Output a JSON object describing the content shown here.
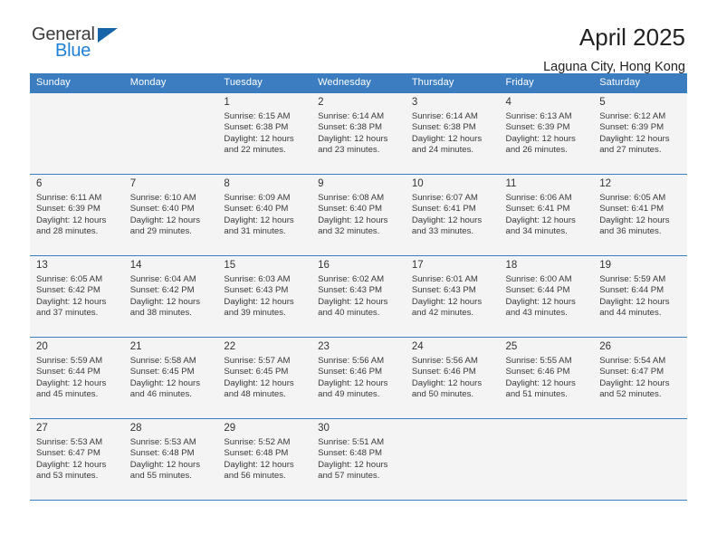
{
  "brand": {
    "name_part1": "General",
    "name_part2": "Blue",
    "accent_color": "#1e7fd4",
    "triangle_color": "#1565a8",
    "triangle_icon": "triangle-icon"
  },
  "header": {
    "title": "April 2025",
    "location": "Laguna City, Hong Kong"
  },
  "calendar": {
    "header_bg": "#3b7dc0",
    "weekday_headers": [
      "Sunday",
      "Monday",
      "Tuesday",
      "Wednesday",
      "Thursday",
      "Friday",
      "Saturday"
    ],
    "labels": {
      "sunrise": "Sunrise:",
      "sunset": "Sunset:",
      "daylight": "Daylight:"
    },
    "weeks": [
      {
        "shaded": true,
        "days": [
          {
            "day": "",
            "sunrise": "",
            "sunset": "",
            "daylight_line1": "",
            "daylight_line2": "",
            "empty": true
          },
          {
            "day": "",
            "sunrise": "",
            "sunset": "",
            "daylight_line1": "",
            "daylight_line2": "",
            "empty": true
          },
          {
            "day": "1",
            "sunrise": "Sunrise: 6:15 AM",
            "sunset": "Sunset: 6:38 PM",
            "daylight_line1": "Daylight: 12 hours",
            "daylight_line2": "and 22 minutes.",
            "empty": false
          },
          {
            "day": "2",
            "sunrise": "Sunrise: 6:14 AM",
            "sunset": "Sunset: 6:38 PM",
            "daylight_line1": "Daylight: 12 hours",
            "daylight_line2": "and 23 minutes.",
            "empty": false
          },
          {
            "day": "3",
            "sunrise": "Sunrise: 6:14 AM",
            "sunset": "Sunset: 6:38 PM",
            "daylight_line1": "Daylight: 12 hours",
            "daylight_line2": "and 24 minutes.",
            "empty": false
          },
          {
            "day": "4",
            "sunrise": "Sunrise: 6:13 AM",
            "sunset": "Sunset: 6:39 PM",
            "daylight_line1": "Daylight: 12 hours",
            "daylight_line2": "and 26 minutes.",
            "empty": false
          },
          {
            "day": "5",
            "sunrise": "Sunrise: 6:12 AM",
            "sunset": "Sunset: 6:39 PM",
            "daylight_line1": "Daylight: 12 hours",
            "daylight_line2": "and 27 minutes.",
            "empty": false
          }
        ]
      },
      {
        "shaded": true,
        "days": [
          {
            "day": "6",
            "sunrise": "Sunrise: 6:11 AM",
            "sunset": "Sunset: 6:39 PM",
            "daylight_line1": "Daylight: 12 hours",
            "daylight_line2": "and 28 minutes.",
            "empty": false
          },
          {
            "day": "7",
            "sunrise": "Sunrise: 6:10 AM",
            "sunset": "Sunset: 6:40 PM",
            "daylight_line1": "Daylight: 12 hours",
            "daylight_line2": "and 29 minutes.",
            "empty": false
          },
          {
            "day": "8",
            "sunrise": "Sunrise: 6:09 AM",
            "sunset": "Sunset: 6:40 PM",
            "daylight_line1": "Daylight: 12 hours",
            "daylight_line2": "and 31 minutes.",
            "empty": false
          },
          {
            "day": "9",
            "sunrise": "Sunrise: 6:08 AM",
            "sunset": "Sunset: 6:40 PM",
            "daylight_line1": "Daylight: 12 hours",
            "daylight_line2": "and 32 minutes.",
            "empty": false
          },
          {
            "day": "10",
            "sunrise": "Sunrise: 6:07 AM",
            "sunset": "Sunset: 6:41 PM",
            "daylight_line1": "Daylight: 12 hours",
            "daylight_line2": "and 33 minutes.",
            "empty": false
          },
          {
            "day": "11",
            "sunrise": "Sunrise: 6:06 AM",
            "sunset": "Sunset: 6:41 PM",
            "daylight_line1": "Daylight: 12 hours",
            "daylight_line2": "and 34 minutes.",
            "empty": false
          },
          {
            "day": "12",
            "sunrise": "Sunrise: 6:05 AM",
            "sunset": "Sunset: 6:41 PM",
            "daylight_line1": "Daylight: 12 hours",
            "daylight_line2": "and 36 minutes.",
            "empty": false
          }
        ]
      },
      {
        "shaded": true,
        "days": [
          {
            "day": "13",
            "sunrise": "Sunrise: 6:05 AM",
            "sunset": "Sunset: 6:42 PM",
            "daylight_line1": "Daylight: 12 hours",
            "daylight_line2": "and 37 minutes.",
            "empty": false
          },
          {
            "day": "14",
            "sunrise": "Sunrise: 6:04 AM",
            "sunset": "Sunset: 6:42 PM",
            "daylight_line1": "Daylight: 12 hours",
            "daylight_line2": "and 38 minutes.",
            "empty": false
          },
          {
            "day": "15",
            "sunrise": "Sunrise: 6:03 AM",
            "sunset": "Sunset: 6:43 PM",
            "daylight_line1": "Daylight: 12 hours",
            "daylight_line2": "and 39 minutes.",
            "empty": false
          },
          {
            "day": "16",
            "sunrise": "Sunrise: 6:02 AM",
            "sunset": "Sunset: 6:43 PM",
            "daylight_line1": "Daylight: 12 hours",
            "daylight_line2": "and 40 minutes.",
            "empty": false
          },
          {
            "day": "17",
            "sunrise": "Sunrise: 6:01 AM",
            "sunset": "Sunset: 6:43 PM",
            "daylight_line1": "Daylight: 12 hours",
            "daylight_line2": "and 42 minutes.",
            "empty": false
          },
          {
            "day": "18",
            "sunrise": "Sunrise: 6:00 AM",
            "sunset": "Sunset: 6:44 PM",
            "daylight_line1": "Daylight: 12 hours",
            "daylight_line2": "and 43 minutes.",
            "empty": false
          },
          {
            "day": "19",
            "sunrise": "Sunrise: 5:59 AM",
            "sunset": "Sunset: 6:44 PM",
            "daylight_line1": "Daylight: 12 hours",
            "daylight_line2": "and 44 minutes.",
            "empty": false
          }
        ]
      },
      {
        "shaded": true,
        "days": [
          {
            "day": "20",
            "sunrise": "Sunrise: 5:59 AM",
            "sunset": "Sunset: 6:44 PM",
            "daylight_line1": "Daylight: 12 hours",
            "daylight_line2": "and 45 minutes.",
            "empty": false
          },
          {
            "day": "21",
            "sunrise": "Sunrise: 5:58 AM",
            "sunset": "Sunset: 6:45 PM",
            "daylight_line1": "Daylight: 12 hours",
            "daylight_line2": "and 46 minutes.",
            "empty": false
          },
          {
            "day": "22",
            "sunrise": "Sunrise: 5:57 AM",
            "sunset": "Sunset: 6:45 PM",
            "daylight_line1": "Daylight: 12 hours",
            "daylight_line2": "and 48 minutes.",
            "empty": false
          },
          {
            "day": "23",
            "sunrise": "Sunrise: 5:56 AM",
            "sunset": "Sunset: 6:46 PM",
            "daylight_line1": "Daylight: 12 hours",
            "daylight_line2": "and 49 minutes.",
            "empty": false
          },
          {
            "day": "24",
            "sunrise": "Sunrise: 5:56 AM",
            "sunset": "Sunset: 6:46 PM",
            "daylight_line1": "Daylight: 12 hours",
            "daylight_line2": "and 50 minutes.",
            "empty": false
          },
          {
            "day": "25",
            "sunrise": "Sunrise: 5:55 AM",
            "sunset": "Sunset: 6:46 PM",
            "daylight_line1": "Daylight: 12 hours",
            "daylight_line2": "and 51 minutes.",
            "empty": false
          },
          {
            "day": "26",
            "sunrise": "Sunrise: 5:54 AM",
            "sunset": "Sunset: 6:47 PM",
            "daylight_line1": "Daylight: 12 hours",
            "daylight_line2": "and 52 minutes.",
            "empty": false
          }
        ]
      },
      {
        "shaded": true,
        "days": [
          {
            "day": "27",
            "sunrise": "Sunrise: 5:53 AM",
            "sunset": "Sunset: 6:47 PM",
            "daylight_line1": "Daylight: 12 hours",
            "daylight_line2": "and 53 minutes.",
            "empty": false
          },
          {
            "day": "28",
            "sunrise": "Sunrise: 5:53 AM",
            "sunset": "Sunset: 6:48 PM",
            "daylight_line1": "Daylight: 12 hours",
            "daylight_line2": "and 55 minutes.",
            "empty": false
          },
          {
            "day": "29",
            "sunrise": "Sunrise: 5:52 AM",
            "sunset": "Sunset: 6:48 PM",
            "daylight_line1": "Daylight: 12 hours",
            "daylight_line2": "and 56 minutes.",
            "empty": false
          },
          {
            "day": "30",
            "sunrise": "Sunrise: 5:51 AM",
            "sunset": "Sunset: 6:48 PM",
            "daylight_line1": "Daylight: 12 hours",
            "daylight_line2": "and 57 minutes.",
            "empty": false
          },
          {
            "day": "",
            "sunrise": "",
            "sunset": "",
            "daylight_line1": "",
            "daylight_line2": "",
            "empty": true
          },
          {
            "day": "",
            "sunrise": "",
            "sunset": "",
            "daylight_line1": "",
            "daylight_line2": "",
            "empty": true
          },
          {
            "day": "",
            "sunrise": "",
            "sunset": "",
            "daylight_line1": "",
            "daylight_line2": "",
            "empty": true
          }
        ]
      }
    ]
  }
}
